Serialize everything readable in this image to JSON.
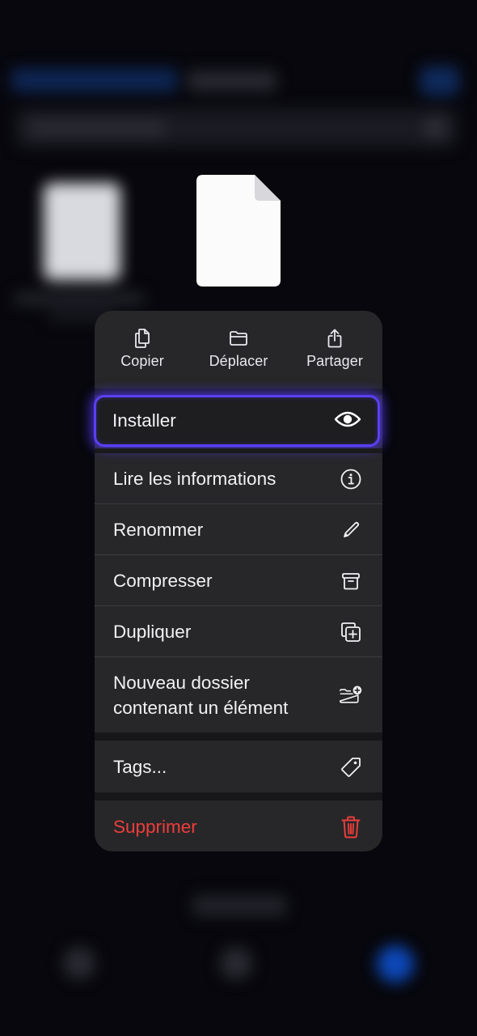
{
  "quick_actions": [
    {
      "label": "Copier",
      "icon": "copy-icon"
    },
    {
      "label": "Déplacer",
      "icon": "folder-icon"
    },
    {
      "label": "Partager",
      "icon": "share-icon"
    }
  ],
  "menu_items": [
    {
      "label": "Installer",
      "icon": "eye-icon",
      "highlighted": true
    },
    {
      "label": "Lire les informations",
      "icon": "info-icon"
    },
    {
      "label": "Renommer",
      "icon": "pencil-icon"
    },
    {
      "label": "Compresser",
      "icon": "archive-icon"
    },
    {
      "label": "Dupliquer",
      "icon": "duplicate-icon"
    },
    {
      "label_line1": "Nouveau dossier",
      "label_line2": "contenant un élément",
      "icon": "folder-plus-icon"
    },
    {
      "label": "Tags...",
      "icon": "tag-icon"
    },
    {
      "label": "Supprimer",
      "icon": "trash-icon",
      "destructive": true
    }
  ],
  "colors": {
    "menu_bg": "#272729",
    "highlight_border": "#5a3ff3",
    "destructive": "#ee3e3b",
    "text": "#f2f2f5"
  }
}
